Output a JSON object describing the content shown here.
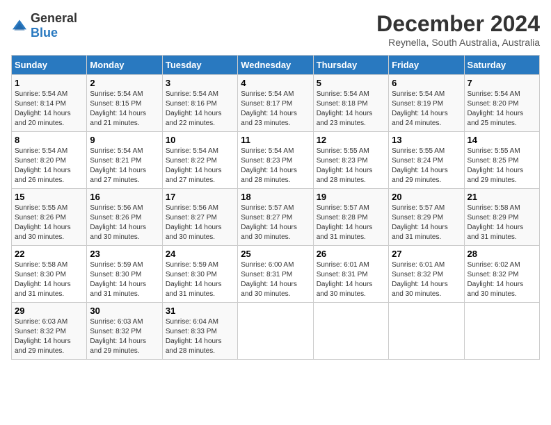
{
  "logo": {
    "general": "General",
    "blue": "Blue"
  },
  "title": "December 2024",
  "subtitle": "Reynella, South Australia, Australia",
  "days_header": [
    "Sunday",
    "Monday",
    "Tuesday",
    "Wednesday",
    "Thursday",
    "Friday",
    "Saturday"
  ],
  "weeks": [
    [
      {
        "day": "1",
        "sunrise": "Sunrise: 5:54 AM",
        "sunset": "Sunset: 8:14 PM",
        "daylight": "Daylight: 14 hours and 20 minutes."
      },
      {
        "day": "2",
        "sunrise": "Sunrise: 5:54 AM",
        "sunset": "Sunset: 8:15 PM",
        "daylight": "Daylight: 14 hours and 21 minutes."
      },
      {
        "day": "3",
        "sunrise": "Sunrise: 5:54 AM",
        "sunset": "Sunset: 8:16 PM",
        "daylight": "Daylight: 14 hours and 22 minutes."
      },
      {
        "day": "4",
        "sunrise": "Sunrise: 5:54 AM",
        "sunset": "Sunset: 8:17 PM",
        "daylight": "Daylight: 14 hours and 23 minutes."
      },
      {
        "day": "5",
        "sunrise": "Sunrise: 5:54 AM",
        "sunset": "Sunset: 8:18 PM",
        "daylight": "Daylight: 14 hours and 23 minutes."
      },
      {
        "day": "6",
        "sunrise": "Sunrise: 5:54 AM",
        "sunset": "Sunset: 8:19 PM",
        "daylight": "Daylight: 14 hours and 24 minutes."
      },
      {
        "day": "7",
        "sunrise": "Sunrise: 5:54 AM",
        "sunset": "Sunset: 8:20 PM",
        "daylight": "Daylight: 14 hours and 25 minutes."
      }
    ],
    [
      {
        "day": "8",
        "sunrise": "Sunrise: 5:54 AM",
        "sunset": "Sunset: 8:20 PM",
        "daylight": "Daylight: 14 hours and 26 minutes."
      },
      {
        "day": "9",
        "sunrise": "Sunrise: 5:54 AM",
        "sunset": "Sunset: 8:21 PM",
        "daylight": "Daylight: 14 hours and 27 minutes."
      },
      {
        "day": "10",
        "sunrise": "Sunrise: 5:54 AM",
        "sunset": "Sunset: 8:22 PM",
        "daylight": "Daylight: 14 hours and 27 minutes."
      },
      {
        "day": "11",
        "sunrise": "Sunrise: 5:54 AM",
        "sunset": "Sunset: 8:23 PM",
        "daylight": "Daylight: 14 hours and 28 minutes."
      },
      {
        "day": "12",
        "sunrise": "Sunrise: 5:55 AM",
        "sunset": "Sunset: 8:23 PM",
        "daylight": "Daylight: 14 hours and 28 minutes."
      },
      {
        "day": "13",
        "sunrise": "Sunrise: 5:55 AM",
        "sunset": "Sunset: 8:24 PM",
        "daylight": "Daylight: 14 hours and 29 minutes."
      },
      {
        "day": "14",
        "sunrise": "Sunrise: 5:55 AM",
        "sunset": "Sunset: 8:25 PM",
        "daylight": "Daylight: 14 hours and 29 minutes."
      }
    ],
    [
      {
        "day": "15",
        "sunrise": "Sunrise: 5:55 AM",
        "sunset": "Sunset: 8:26 PM",
        "daylight": "Daylight: 14 hours and 30 minutes."
      },
      {
        "day": "16",
        "sunrise": "Sunrise: 5:56 AM",
        "sunset": "Sunset: 8:26 PM",
        "daylight": "Daylight: 14 hours and 30 minutes."
      },
      {
        "day": "17",
        "sunrise": "Sunrise: 5:56 AM",
        "sunset": "Sunset: 8:27 PM",
        "daylight": "Daylight: 14 hours and 30 minutes."
      },
      {
        "day": "18",
        "sunrise": "Sunrise: 5:57 AM",
        "sunset": "Sunset: 8:27 PM",
        "daylight": "Daylight: 14 hours and 30 minutes."
      },
      {
        "day": "19",
        "sunrise": "Sunrise: 5:57 AM",
        "sunset": "Sunset: 8:28 PM",
        "daylight": "Daylight: 14 hours and 31 minutes."
      },
      {
        "day": "20",
        "sunrise": "Sunrise: 5:57 AM",
        "sunset": "Sunset: 8:29 PM",
        "daylight": "Daylight: 14 hours and 31 minutes."
      },
      {
        "day": "21",
        "sunrise": "Sunrise: 5:58 AM",
        "sunset": "Sunset: 8:29 PM",
        "daylight": "Daylight: 14 hours and 31 minutes."
      }
    ],
    [
      {
        "day": "22",
        "sunrise": "Sunrise: 5:58 AM",
        "sunset": "Sunset: 8:30 PM",
        "daylight": "Daylight: 14 hours and 31 minutes."
      },
      {
        "day": "23",
        "sunrise": "Sunrise: 5:59 AM",
        "sunset": "Sunset: 8:30 PM",
        "daylight": "Daylight: 14 hours and 31 minutes."
      },
      {
        "day": "24",
        "sunrise": "Sunrise: 5:59 AM",
        "sunset": "Sunset: 8:30 PM",
        "daylight": "Daylight: 14 hours and 31 minutes."
      },
      {
        "day": "25",
        "sunrise": "Sunrise: 6:00 AM",
        "sunset": "Sunset: 8:31 PM",
        "daylight": "Daylight: 14 hours and 30 minutes."
      },
      {
        "day": "26",
        "sunrise": "Sunrise: 6:01 AM",
        "sunset": "Sunset: 8:31 PM",
        "daylight": "Daylight: 14 hours and 30 minutes."
      },
      {
        "day": "27",
        "sunrise": "Sunrise: 6:01 AM",
        "sunset": "Sunset: 8:32 PM",
        "daylight": "Daylight: 14 hours and 30 minutes."
      },
      {
        "day": "28",
        "sunrise": "Sunrise: 6:02 AM",
        "sunset": "Sunset: 8:32 PM",
        "daylight": "Daylight: 14 hours and 30 minutes."
      }
    ],
    [
      {
        "day": "29",
        "sunrise": "Sunrise: 6:03 AM",
        "sunset": "Sunset: 8:32 PM",
        "daylight": "Daylight: 14 hours and 29 minutes."
      },
      {
        "day": "30",
        "sunrise": "Sunrise: 6:03 AM",
        "sunset": "Sunset: 8:32 PM",
        "daylight": "Daylight: 14 hours and 29 minutes."
      },
      {
        "day": "31",
        "sunrise": "Sunrise: 6:04 AM",
        "sunset": "Sunset: 8:33 PM",
        "daylight": "Daylight: 14 hours and 28 minutes."
      },
      null,
      null,
      null,
      null
    ]
  ]
}
